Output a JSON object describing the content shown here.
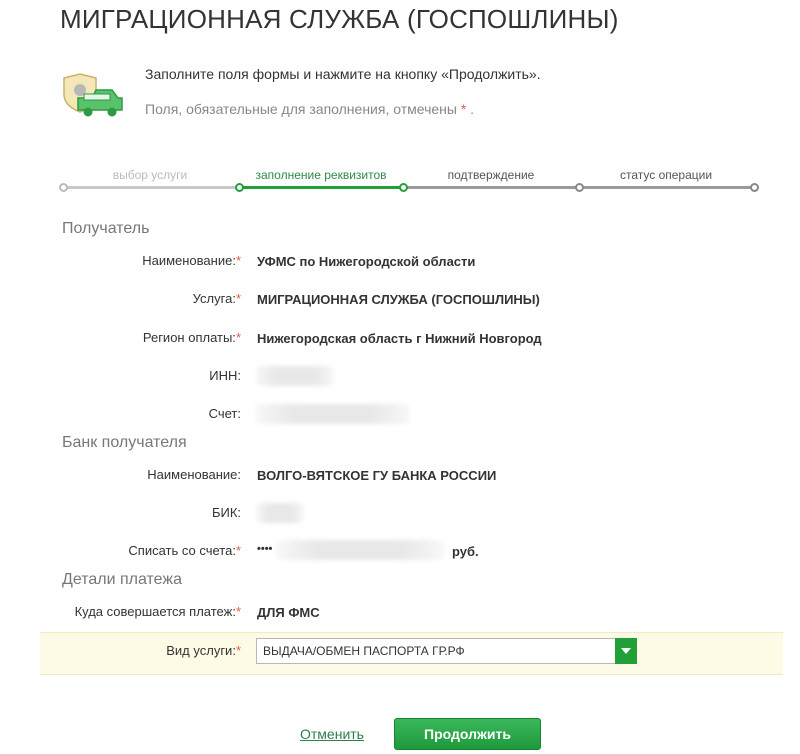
{
  "header": {
    "title": "МИГРАЦИОННАЯ СЛУЖБА (ГОСПОШЛИНЫ)"
  },
  "info": {
    "line1": "Заполните поля формы и нажмите на кнопку «Продолжить».",
    "line2": "Поля, обязательные для заполнения, отмечены",
    "star": "*",
    "line2_end": "."
  },
  "steps": [
    {
      "label": "выбор услуги",
      "state": "done"
    },
    {
      "label": "заполнение реквизитов",
      "state": "active"
    },
    {
      "label": "подтверждение",
      "state": "pending"
    },
    {
      "label": "статус операции",
      "state": "pending"
    }
  ],
  "recipient": {
    "title": "Получатель",
    "name_label": "Наименование:",
    "name_value": "УФМС по Нижегородской области",
    "service_label": "Услуга:",
    "service_value": "МИГРАЦИОННАЯ СЛУЖБА (ГОСПОШЛИНЫ)",
    "region_label": "Регион оплаты:",
    "region_value": "Нижегородская область г Нижний Новгород",
    "inn_label": "ИНН:",
    "account_label": "Счет:"
  },
  "bank": {
    "title": "Банк получателя",
    "name_label": "Наименование:",
    "name_value": "ВОЛГО-ВЯТСКОЕ ГУ БАНКА РОССИИ",
    "bik_label": "БИК:",
    "debit_label": "Списать со счета:",
    "debit_masked": "••••",
    "debit_currency": "руб."
  },
  "details": {
    "title": "Детали платежа",
    "dest_label": "Куда совершается платеж:",
    "dest_value": "ДЛЯ ФМС",
    "service_type_label": "Вид услуги:",
    "service_type_value": "ВЫДАЧА/ОБМЕН ПАСПОРТА ГР.РФ"
  },
  "required_mark": "*",
  "actions": {
    "cancel": "Отменить",
    "continue": "Продолжить"
  },
  "colors": {
    "accent": "#21a038",
    "required": "#e05a4a",
    "highlight": "#fdfbe6"
  }
}
